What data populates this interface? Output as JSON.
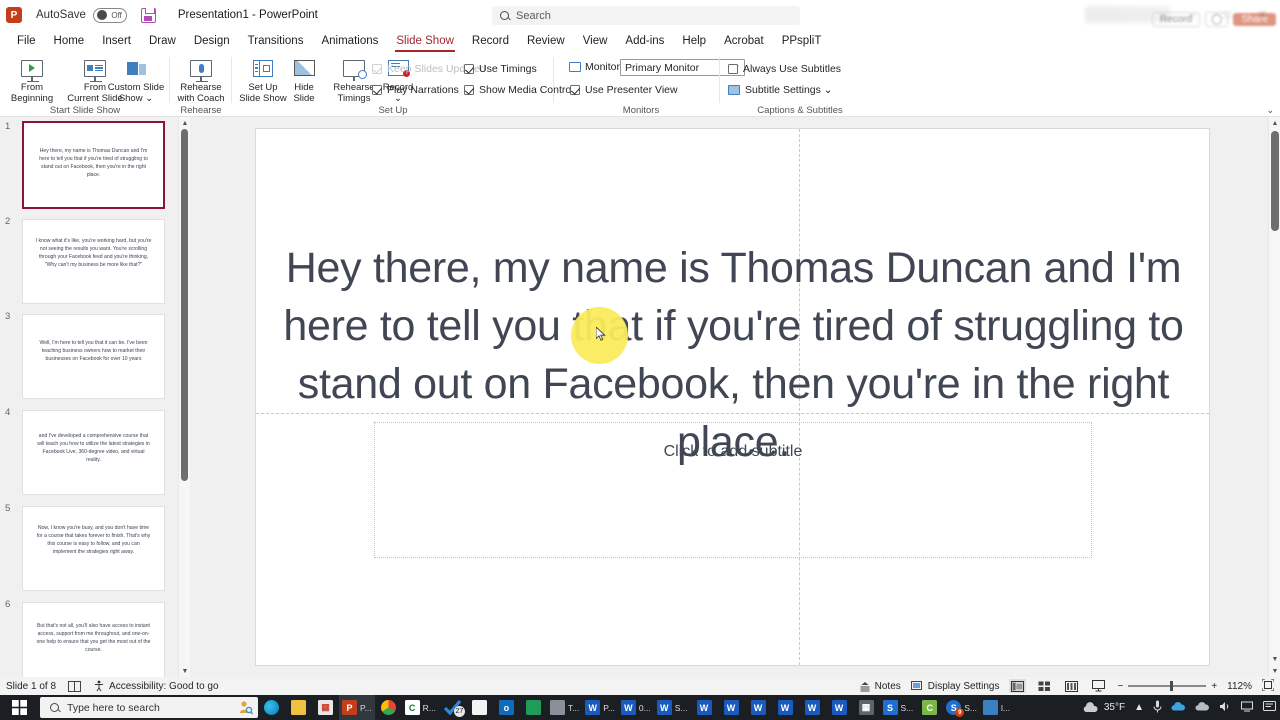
{
  "titlebar": {
    "app_logo": "powerpoint-logo",
    "autosave_label": "AutoSave",
    "autosave_state": "Off",
    "save_icon": "save-icon",
    "document_title": "Presentation1  -  PowerPoint"
  },
  "search": {
    "placeholder": "Search",
    "icon": "search-icon"
  },
  "tabs": [
    {
      "label": "File",
      "active": false
    },
    {
      "label": "Home",
      "active": false
    },
    {
      "label": "Insert",
      "active": false
    },
    {
      "label": "Draw",
      "active": false
    },
    {
      "label": "Design",
      "active": false
    },
    {
      "label": "Transitions",
      "active": false
    },
    {
      "label": "Animations",
      "active": false
    },
    {
      "label": "Slide Show",
      "active": true
    },
    {
      "label": "Record",
      "active": false
    },
    {
      "label": "Review",
      "active": false
    },
    {
      "label": "View",
      "active": false
    },
    {
      "label": "Add-ins",
      "active": false
    },
    {
      "label": "Help",
      "active": false
    },
    {
      "label": "Acrobat",
      "active": false
    },
    {
      "label": "PPspliT",
      "active": false
    }
  ],
  "topright": {
    "record_label": "Record",
    "share_label": "Share"
  },
  "ribbon": {
    "groups": [
      {
        "name": "Start Slide Show",
        "label": "Start Slide Show"
      },
      {
        "name": "Rehearse",
        "label": "Rehearse"
      },
      {
        "name": "Set Up",
        "label": "Set Up"
      },
      {
        "name": "Monitors",
        "label": "Monitors"
      },
      {
        "name": "Captions & Subtitles",
        "label": "Captions & Subtitles"
      }
    ],
    "buttons": {
      "from_beginning": "From\nBeginning",
      "from_beginning_l1": "From",
      "from_beginning_l2": "Beginning",
      "from_current_l1": "From",
      "from_current_l2": "Current Slide",
      "custom_show_l1": "Custom Slide",
      "custom_show_l2": "Show ⌄",
      "rehearse_coach_l1": "Rehearse",
      "rehearse_coach_l2": "with Coach",
      "set_up_show_l1": "Set Up",
      "set_up_show_l2": "Slide Show",
      "hide_slide_l1": "Hide",
      "hide_slide_l2": "Slide",
      "rehearse_timings_l1": "Rehearse",
      "rehearse_timings_l2": "Timings",
      "record_l1": "Record",
      "record_l2": "⌄"
    },
    "checkboxes": [
      {
        "label": "Keep Slides Updated",
        "checked": true,
        "disabled": true
      },
      {
        "label": "Play Narrations",
        "checked": true,
        "disabled": false
      },
      {
        "label": "Use Timings",
        "checked": true,
        "disabled": false
      },
      {
        "label": "Show Media Controls",
        "checked": true,
        "disabled": false
      },
      {
        "label": "Use Presenter View",
        "checked": true,
        "disabled": false
      },
      {
        "label": "Always Use Subtitles",
        "checked": false,
        "disabled": false
      }
    ],
    "monitor": {
      "label": "Monitor:",
      "value": "Primary Monitor"
    },
    "subtitle_settings": "Subtitle Settings ⌄",
    "collapse": "⌄"
  },
  "thumbnails": [
    {
      "number": "1",
      "text": "Hey there, my name is Thomas Duncan and I'm here to tell you that if you're tired of struggling to stand out on Facebook, then you're in the right place.",
      "selected": true
    },
    {
      "number": "2",
      "text": "I know what it's like, you're working hard, but you're not seeing the results you want. You're scrolling through your Facebook feed and you're thinking, \"Why can't my business be more like that?\"",
      "selected": false
    },
    {
      "number": "3",
      "text": "Well, I'm here to tell you that it can be. I've been teaching business owners how to market their businesses on Facebook for over 10 years",
      "selected": false
    },
    {
      "number": "4",
      "text": "and I've developed a comprehensive course that will teach you how to utilize the latest strategies in Facebook Live, 360-degree video, and virtual reality.",
      "selected": false
    },
    {
      "number": "5",
      "text": "Now, I know you're busy, and you don't have time for a course that takes forever to finish. That's why this course is easy to follow, and you can implement the strategies right away.",
      "selected": false
    },
    {
      "number": "6",
      "text": "But that's not all, you'll also have access to instant access, support from me throughout, and one-on-one help to ensure that you get the most out of the course.",
      "selected": false
    }
  ],
  "slide": {
    "title_text": "Hey there, my name is Thomas Duncan and I'm here to tell you that if you're tired of struggling to stand out on Facebook, then you're in the right place.",
    "subtitle_placeholder": "Click to add subtitle"
  },
  "statusbar": {
    "slide_count": "Slide 1 of 8",
    "notes_page_icon": "notes-page-icon",
    "accessibility": "Accessibility: Good to go",
    "notes_label": "Notes",
    "display_settings_label": "Display Settings",
    "views": [
      "normal-view-icon",
      "slide-sorter-icon",
      "reading-view-icon",
      "slideshow-view-icon"
    ],
    "zoom_out": "−",
    "zoom_in": "+",
    "zoom_level": "112%",
    "fit_slide_icon": "fit-slide-icon"
  },
  "taskbar": {
    "start_icon": "windows-start-icon",
    "search_placeholder": "Type here to search",
    "cortana_icon": "cortana-icon",
    "items": [
      {
        "name": "edge",
        "label": "",
        "color": "#0e7ab5",
        "glyph": "e"
      },
      {
        "name": "file-explorer",
        "label": "",
        "color": "#f0c040",
        "glyph": ""
      },
      {
        "name": "microsoft-store",
        "label": "",
        "color": "#e8e8e8",
        "glyph": ""
      },
      {
        "name": "powerpoint",
        "label": "P...",
        "color": "#c43e1c",
        "glyph": "P"
      },
      {
        "name": "chrome",
        "label": "",
        "color": "#e8e8e8",
        "glyph": ""
      },
      {
        "name": "camtasia",
        "label": "R...",
        "color": "#ffffff",
        "glyph": "C"
      },
      {
        "name": "todo-check",
        "label": "27",
        "color": "#2f6fd0",
        "glyph": ""
      },
      {
        "name": "notepad",
        "label": "",
        "color": "#f4f4f4",
        "glyph": ""
      },
      {
        "name": "outlook",
        "label": "",
        "color": "#0f6cbd",
        "glyph": "o"
      },
      {
        "name": "teams-green",
        "label": "",
        "color": "#1f9c5a",
        "glyph": ""
      },
      {
        "name": "media-player",
        "label": "T...",
        "color": "#8a9099",
        "glyph": ""
      },
      {
        "name": "word-1",
        "label": "P...",
        "color": "#185abd",
        "glyph": "W"
      },
      {
        "name": "word-2",
        "label": "0...",
        "color": "#185abd",
        "glyph": "W"
      },
      {
        "name": "word-3",
        "label": "S...",
        "color": "#185abd",
        "glyph": "W"
      },
      {
        "name": "word-4",
        "label": "",
        "color": "#185abd",
        "glyph": "W"
      },
      {
        "name": "word-5",
        "label": "",
        "color": "#185abd",
        "glyph": "W"
      },
      {
        "name": "word-6",
        "label": "",
        "color": "#185abd",
        "glyph": "W"
      },
      {
        "name": "word-7",
        "label": "",
        "color": "#185abd",
        "glyph": "W"
      },
      {
        "name": "word-8",
        "label": "",
        "color": "#185abd",
        "glyph": "W"
      },
      {
        "name": "word-9",
        "label": "",
        "color": "#185abd",
        "glyph": "W"
      },
      {
        "name": "calculator",
        "label": "",
        "color": "#5a6570",
        "glyph": ""
      },
      {
        "name": "snagit",
        "label": "S...",
        "color": "#1f6fd0",
        "glyph": "S"
      },
      {
        "name": "camtasia-2",
        "label": "",
        "color": "#7ab648",
        "glyph": "C"
      },
      {
        "name": "snagit-editor",
        "label": "S...",
        "color": "#1f6fd0",
        "glyph": "S"
      },
      {
        "name": "photos",
        "label": "l...",
        "color": "#3a7fc1",
        "glyph": ""
      }
    ],
    "weather_temp": "35°F",
    "weather_icon": "cloud-icon",
    "tray": [
      "chevron-up-icon",
      "microphone-icon",
      "onedrive-icon",
      "cloud-icon",
      "volume-icon",
      "network-icon",
      "action-center-icon"
    ]
  },
  "colors": {
    "accent": "#a4262c",
    "selection": "#8a1538",
    "slide_text": "#404654",
    "cursor_halo": "#faec5c"
  }
}
